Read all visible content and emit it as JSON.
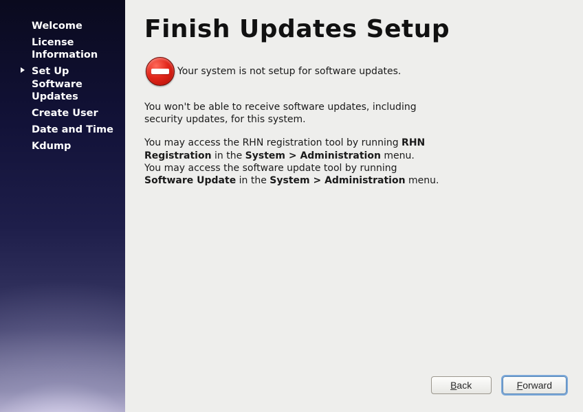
{
  "sidebar": {
    "items": [
      {
        "label": "Welcome",
        "active": false
      },
      {
        "label": "License Information",
        "active": false
      },
      {
        "label": "Set Up Software Updates",
        "active": true
      },
      {
        "label": "Create User",
        "active": false
      },
      {
        "label": "Date and Time",
        "active": false
      },
      {
        "label": "Kdump",
        "active": false
      }
    ]
  },
  "main": {
    "title": "Finish Updates Setup",
    "warning": "Your system is not setup for software updates.",
    "para1": "You won't be able to receive software updates, including security updates, for this system.",
    "para2_a": "You may access the RHN registration tool by running ",
    "para2_b": "RHN Registration",
    "para2_c": " in the ",
    "para2_d": "System > Administration",
    "para2_e": " menu.",
    "para3_a": "You may access the software update tool by running ",
    "para3_b": "Software Update",
    "para3_c": " in the ",
    "para3_d": "System > Administration",
    "para3_e": " menu."
  },
  "footer": {
    "back_rest": "ack",
    "forward_rest": "orward",
    "back_mn": "B",
    "forward_mn": "F"
  }
}
